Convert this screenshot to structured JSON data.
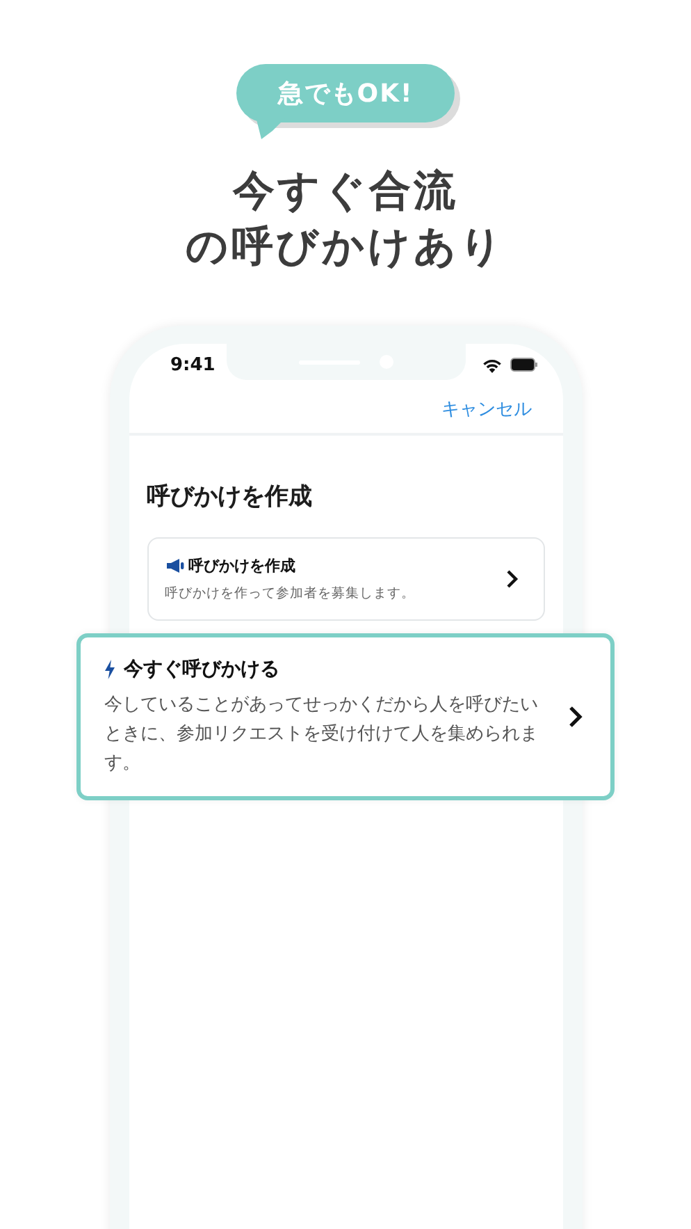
{
  "badge": "急でもOK!",
  "headline": [
    "今すぐ合流",
    "の呼びかけあり"
  ],
  "phone": {
    "status_time": "9:41",
    "nav": {
      "cancel": "キャンセル"
    },
    "title": "呼びかけを作成",
    "card": {
      "title": "呼びかけを作成",
      "description": "呼びかけを作って参加者を募集します。"
    }
  },
  "highlight_card": {
    "title": "今すぐ呼びかける",
    "description": "今していることがあってせっかくだから人を呼びたいときに、参加リクエストを受け付けて人を集められます。"
  }
}
